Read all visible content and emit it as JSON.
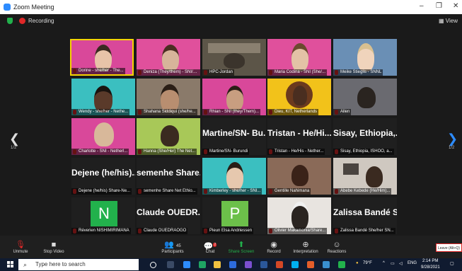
{
  "window": {
    "title": "Zoom Meeting",
    "minimize": "–",
    "maximize": "❐",
    "close": "✕"
  },
  "recording": {
    "label": "Recording",
    "view": "View"
  },
  "nav": {
    "page_left": "1/2",
    "page_right": "1/2",
    "prev": "❮",
    "next": "❯"
  },
  "tiles": [
    {
      "label": "Dorine - she/her - The..."
    },
    {
      "label": "Deniza (They/them) - SNI/KIT"
    },
    {
      "label": "HPC-Jordan"
    },
    {
      "label": "Maria Codina - SNI (She/..."
    },
    {
      "label": "Meike Stieglis - SNNL"
    },
    {
      "label": "Wendy - she/her - Nethe..."
    },
    {
      "label": "Shahana Siddiqui (she/he..."
    },
    {
      "label": "Rhian - SNI (they/Them)..."
    },
    {
      "label": "Dieu, KIT, Netherlands"
    },
    {
      "label": "Allen"
    },
    {
      "label": "Charlotte - SNI - Netherl..."
    },
    {
      "label": "Hanna (She/Her) The Net..."
    },
    {
      "label": "Martine/SN- Burundi",
      "big": "Martine/SN- Bu..."
    },
    {
      "label": "Tristan - He/His - Nether...",
      "big": "Tristan - He/Hi..."
    },
    {
      "label": "Sisay, Ethiopia, ISHOO, a...",
      "big": "Sisay, Ethiopia,..."
    },
    {
      "label": "Dejene (he/his) Share-Ne...",
      "big": "Dejene (he/his)..."
    },
    {
      "label": "semenhe Share Net Ethio...",
      "big": "semenhe Share..."
    },
    {
      "label": "Kimberley - she/her - SNI..."
    },
    {
      "label": "Gentille Nahimana"
    },
    {
      "label": "Abebe Kebede (He/Him)..."
    },
    {
      "label": "Réverien NISHIMIRIMANA",
      "letter": "N"
    },
    {
      "label": "Claude OUEDRAOGO",
      "big": "Claude OUEDR..."
    },
    {
      "label": "Pieun Elsa Andriessen",
      "letter": "P"
    },
    {
      "label": "Olivier Makamonia/Share..."
    },
    {
      "label": "Zalissa Bandé She/her SN...",
      "big": "Zalissa Bandé S..."
    }
  ],
  "toolbar": {
    "unmute": "Unmute",
    "stop_video": "Stop Video",
    "participants": "Participants",
    "participants_count": "45",
    "chat": "Chat",
    "chat_badge": "2",
    "share_screen": "Share Screen",
    "record": "Record",
    "interpretation": "Interpretation",
    "reactions": "Reactions",
    "leave_tooltip": "Leave (Alt+Q)"
  },
  "taskbar": {
    "search_placeholder": "Type here to search",
    "weather": "79°F",
    "lang": "ENG",
    "time": "2:14 PM",
    "date": "9/28/2021"
  },
  "colors": {
    "share": "#22b14c",
    "recording": "#e02828",
    "letter_tile": "#22b14c",
    "pink": "#e0509c",
    "teal": "#3bbfc0"
  }
}
